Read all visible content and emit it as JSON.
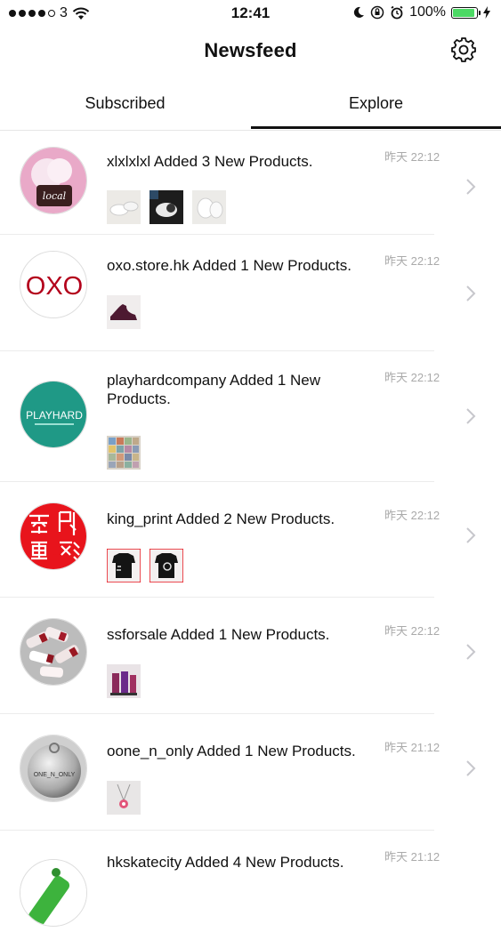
{
  "status": {
    "carrier": "3",
    "time": "12:41",
    "battery": "100%"
  },
  "header": {
    "title": "Newsfeed"
  },
  "tabs": [
    {
      "label": "Subscribed"
    },
    {
      "label": "Explore"
    }
  ],
  "feed": [
    {
      "title": "xlxlxlxl Added 3 New Products.",
      "time": "昨天 22:12",
      "thumb_count": 3,
      "avatar_text": "local"
    },
    {
      "title": "oxo.store.hk Added 1 New Products.",
      "time": "昨天 22:12",
      "thumb_count": 1,
      "avatar_text": "OXO"
    },
    {
      "title": "playhardcompany Added 1 New Products.",
      "time": "昨天 22:12",
      "thumb_count": 1,
      "avatar_text": "PLAYHARD"
    },
    {
      "title": "king_print Added 2 New Products.",
      "time": "昨天 22:12",
      "thumb_count": 2,
      "avatar_text": "至印尊衫"
    },
    {
      "title": "ssforsale Added 1 New Products.",
      "time": "昨天 22:12",
      "thumb_count": 1,
      "avatar_text": ""
    },
    {
      "title": "oone_n_only Added 1 New Products.",
      "time": "昨天 21:12",
      "thumb_count": 1,
      "avatar_text": "ONE_N_ONLY"
    },
    {
      "title": "hkskatecity Added 4 New Products.",
      "time": "昨天 21:12",
      "thumb_count": 0,
      "avatar_text": ""
    }
  ],
  "colors": {
    "accent_battery": "#4cd964",
    "oxo_red": "#b3001b",
    "playhard_teal": "#1f9986",
    "stamp_red": "#e8141c"
  }
}
